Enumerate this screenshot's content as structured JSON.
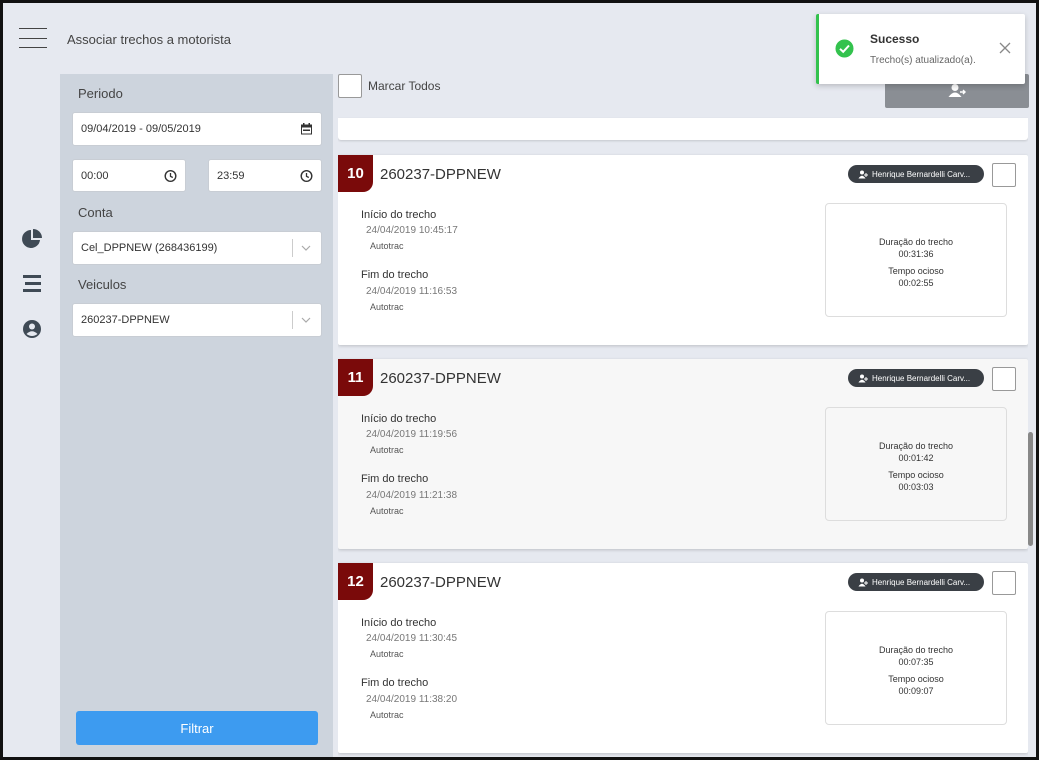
{
  "header": {
    "title": "Associar trechos a motorista"
  },
  "filters": {
    "periodo_label": "Periodo",
    "periodo_value": "09/04/2019 - 09/05/2019",
    "hora_inicio": "00:00",
    "hora_fim": "23:59",
    "conta_label": "Conta",
    "conta_value": "Cel_DPPNEW (268436199)",
    "veiculos_label": "Veiculos",
    "veiculos_value": "260237-DPPNEW",
    "filter_button": "Filtrar"
  },
  "list_header": {
    "mark_all_label": "Marcar Todos"
  },
  "cards": [
    {
      "number": "10",
      "title": "260237-DPPNEW",
      "driver": "Henrique Bernardelli Carv...",
      "start_label": "Início do trecho",
      "start_time": "24/04/2019 10:45:17",
      "start_source": "Autotrac",
      "end_label": "Fim do trecho",
      "end_time": "24/04/2019 11:16:53",
      "end_source": "Autotrac",
      "duration_label": "Duração do trecho",
      "duration_value": "00:31:36",
      "idle_label": "Tempo ocioso",
      "idle_value": "00:02:55"
    },
    {
      "number": "11",
      "title": "260237-DPPNEW",
      "driver": "Henrique Bernardelli Carv...",
      "start_label": "Início do trecho",
      "start_time": "24/04/2019 11:19:56",
      "start_source": "Autotrac",
      "end_label": "Fim do trecho",
      "end_time": "24/04/2019 11:21:38",
      "end_source": "Autotrac",
      "duration_label": "Duração do trecho",
      "duration_value": "00:01:42",
      "idle_label": "Tempo ocioso",
      "idle_value": "00:03:03"
    },
    {
      "number": "12",
      "title": "260237-DPPNEW",
      "driver": "Henrique Bernardelli Carv...",
      "start_label": "Início do trecho",
      "start_time": "24/04/2019 11:30:45",
      "start_source": "Autotrac",
      "end_label": "Fim do trecho",
      "end_time": "24/04/2019 11:38:20",
      "end_source": "Autotrac",
      "duration_label": "Duração do trecho",
      "duration_value": "00:07:35",
      "idle_label": "Tempo ocioso",
      "idle_value": "00:09:07"
    }
  ],
  "toast": {
    "title": "Sucesso",
    "message": "Trecho(s) atualizado(a).",
    "accent": "#33c24d"
  },
  "icons": {
    "menu": "hamburger-icon",
    "nav": [
      "pie-chart-icon",
      "list-icon",
      "user-circle-icon"
    ],
    "calendar": "calendar-icon",
    "clock": "clock-icon",
    "chevron": "chevron-down-icon",
    "assign": "user-assign-icon"
  },
  "colors": {
    "badge": "#7a0a0a",
    "filter_button": "#3d9bf0",
    "driver_pill": "#3a3f45",
    "panel": "#cdd4dd",
    "background": "#e6e9f0"
  }
}
